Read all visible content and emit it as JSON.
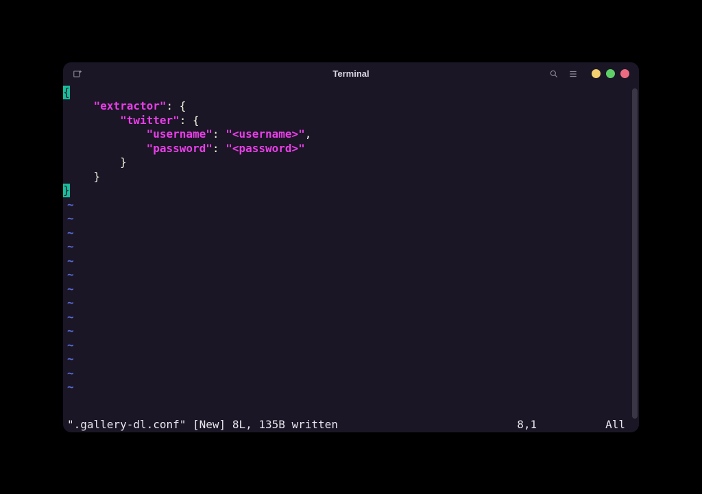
{
  "window": {
    "title": "Terminal"
  },
  "editor": {
    "lines": [
      {
        "type": "cursor-open",
        "text": "{"
      },
      {
        "type": "code",
        "indent": "    ",
        "key": "\"extractor\"",
        "after": ": {"
      },
      {
        "type": "code",
        "indent": "        ",
        "key": "\"twitter\"",
        "after": ": {"
      },
      {
        "type": "code-kv",
        "indent": "            ",
        "key": "\"username\"",
        "sep": ": ",
        "val": "\"<username>\"",
        "trail": ","
      },
      {
        "type": "code-kv",
        "indent": "            ",
        "key": "\"password\"",
        "sep": ": ",
        "val": "\"<password>\"",
        "trail": ""
      },
      {
        "type": "plain",
        "indent": "        ",
        "text": "}"
      },
      {
        "type": "plain",
        "indent": "    ",
        "text": "}"
      },
      {
        "type": "cursor-close",
        "text": "}"
      }
    ],
    "tilde_count": 14
  },
  "status": {
    "left": "\".gallery-dl.conf\" [New] 8L, 135B written",
    "position": "8,1",
    "scroll": "All"
  },
  "icons": {
    "add_tab": "add-tab-icon",
    "search": "search-icon",
    "menu": "hamburger-icon"
  }
}
